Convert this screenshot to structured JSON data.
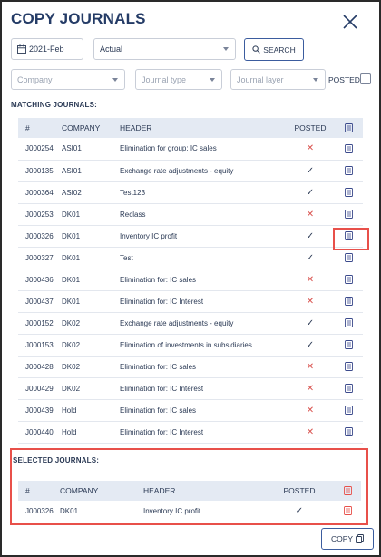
{
  "dialog": {
    "title": "COPY JOURNALS"
  },
  "filters": {
    "period": "2021-Feb",
    "scenario": "Actual",
    "search_label": "SEARCH",
    "company_placeholder": "Company",
    "journal_type_placeholder": "Journal type",
    "journal_layer_placeholder": "Journal layer",
    "posted_label": "POSTED"
  },
  "matching": {
    "section_label": "MATCHING JOURNALS:",
    "columns": [
      "#",
      "COMPANY",
      "HEADER",
      "POSTED",
      ""
    ],
    "rows": [
      {
        "num": "J000254",
        "company": "ASI01",
        "header": "Elimination for group: IC sales",
        "posted": "✕"
      },
      {
        "num": "J000135",
        "company": "ASI01",
        "header": "Exchange rate adjustments - equity",
        "posted": "✓"
      },
      {
        "num": "J000364",
        "company": "ASI02",
        "header": "Test123",
        "posted": "✓"
      },
      {
        "num": "J000253",
        "company": "DK01",
        "header": "Reclass",
        "posted": "✕"
      },
      {
        "num": "J000326",
        "company": "DK01",
        "header": "Inventory IC profit",
        "posted": "✓"
      },
      {
        "num": "J000327",
        "company": "DK01",
        "header": "Test",
        "posted": "✓"
      },
      {
        "num": "J000436",
        "company": "DK01",
        "header": "Elimination for: IC sales",
        "posted": "✕"
      },
      {
        "num": "J000437",
        "company": "DK01",
        "header": "Elimination for: IC Interest",
        "posted": "✕"
      },
      {
        "num": "J000152",
        "company": "DK02",
        "header": "Exchange rate adjustments - equity",
        "posted": "✓"
      },
      {
        "num": "J000153",
        "company": "DK02",
        "header": "Elimination of investments in subsidiaries",
        "posted": "✓"
      },
      {
        "num": "J000428",
        "company": "DK02",
        "header": "Elimination for: IC sales",
        "posted": "✕"
      },
      {
        "num": "J000429",
        "company": "DK02",
        "header": "Elimination for: IC Interest",
        "posted": "✕"
      },
      {
        "num": "J000439",
        "company": "Hold",
        "header": "Elimination for: IC sales",
        "posted": "✕"
      },
      {
        "num": "J000440",
        "company": "Hold",
        "header": "Elimination for: IC Interest",
        "posted": "✕"
      }
    ]
  },
  "selected": {
    "section_label": "SELECTED JOURNALS:",
    "columns": [
      "#",
      "COMPANY",
      "HEADER",
      "POSTED",
      ""
    ],
    "rows": [
      {
        "num": "J000326",
        "company": "DK01",
        "header": "Inventory IC profit",
        "posted": "✓"
      }
    ]
  },
  "footer": {
    "copy_label": "COPY"
  },
  "colors": {
    "accent": "#243b66",
    "remove": "#e8504a",
    "header_bg": "#e4eaf3",
    "cross": "#d9534f"
  },
  "icons": {
    "close": "close-icon",
    "calendar": "calendar-icon",
    "search": "search-icon",
    "row_action": "document-icon",
    "remove": "remove-document-icon",
    "copy": "copy-icon"
  }
}
